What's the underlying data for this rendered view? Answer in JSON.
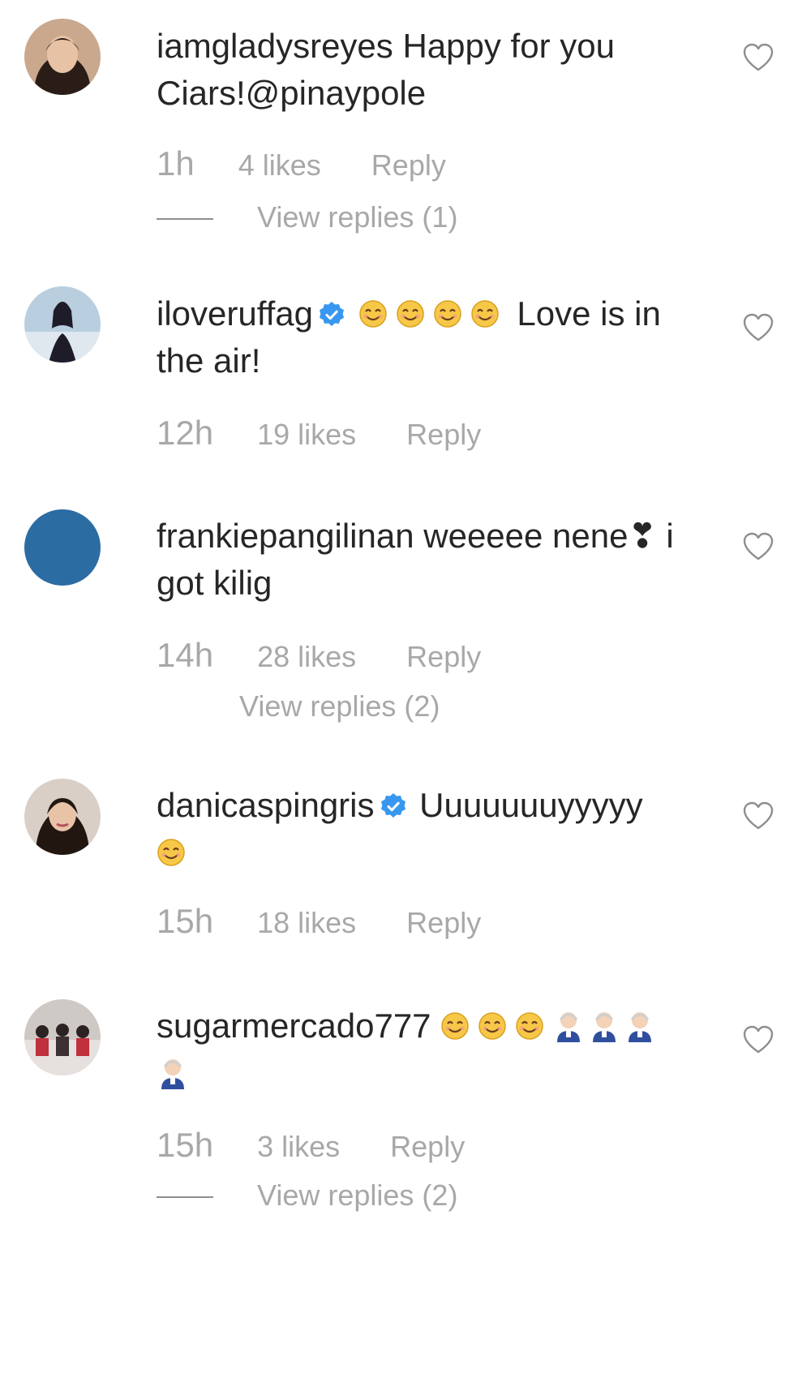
{
  "comments": [
    {
      "username": "iamgladysreyes",
      "verified": false,
      "text": "Happy for you Ciars!@pinaypole",
      "time": "1h",
      "likes": "4 likes",
      "reply": "Reply",
      "view_replies": "View replies (1)"
    },
    {
      "username": "iloveruffag",
      "verified": true,
      "text": "Love is in the air!",
      "time": "12h",
      "likes": "19 likes",
      "reply": "Reply"
    },
    {
      "username": "frankiepangilinan",
      "verified": false,
      "text": "weeeee nene❣ i got kilig",
      "time": "14h",
      "likes": "28 likes",
      "reply": "Reply",
      "view_replies": "View replies (2)"
    },
    {
      "username": "danicaspingris",
      "verified": true,
      "text": "Uuuuuuuyyyyy",
      "time": "15h",
      "likes": "18 likes",
      "reply": "Reply"
    },
    {
      "username": "sugarmercado777",
      "verified": false,
      "text": "",
      "time": "15h",
      "likes": "3 likes",
      "reply": "Reply",
      "view_replies": "View replies (2)"
    }
  ],
  "colors": {
    "text": "#262626",
    "meta": "#a8a8a8",
    "verified": "#3897f0",
    "avatar_blue": "#2b6ca3"
  },
  "icons": {
    "like": "heart-outline-icon",
    "verified": "verified-badge-icon",
    "emoji_smile": "smiling-face-emoji",
    "emoji_old": "old-couple-emoji"
  }
}
